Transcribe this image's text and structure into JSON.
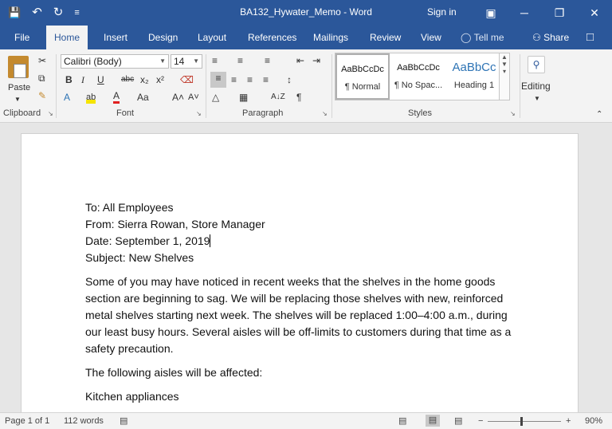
{
  "titlebar": {
    "doc_title": "BA132_Hywater_Memo  -  Word",
    "sign_in": "Sign in",
    "save_icon": "💾",
    "undo_icon": "↶",
    "redo_icon": "↻",
    "customize_icon": "≡",
    "ribbon_display_icon": "▣",
    "minimize_icon": "─",
    "restore_icon": "❐",
    "close_icon": "✕"
  },
  "tabs": [
    {
      "label": "File"
    },
    {
      "label": "Home"
    },
    {
      "label": "Insert"
    },
    {
      "label": "Design"
    },
    {
      "label": "Layout"
    },
    {
      "label": "References"
    },
    {
      "label": "Mailings"
    },
    {
      "label": "Review"
    },
    {
      "label": "View"
    }
  ],
  "tell_me": "Tell me",
  "share": "Share",
  "ribbon": {
    "clipboard": {
      "label": "Clipboard",
      "paste": "Paste"
    },
    "font": {
      "label": "Font",
      "font_name": "Calibri (Body)",
      "font_size": "14",
      "bold": "B",
      "italic": "I",
      "underline": "U",
      "strike": "abc",
      "subscript": "x₂",
      "superscript": "x²",
      "change_case": "Aa",
      "grow": "A˄",
      "shrink": "A˅",
      "font_color": "A",
      "highlight": "ab",
      "effects": "A"
    },
    "paragraph": {
      "label": "Paragraph",
      "pilcrow": "¶",
      "sort": "A↓Z"
    },
    "styles": {
      "label": "Styles",
      "items": [
        {
          "sample": "AaBbCcDc",
          "name": "¶ Normal"
        },
        {
          "sample": "AaBbCcDc",
          "name": "¶ No Spac..."
        },
        {
          "sample": "AaBbCc",
          "name": "Heading 1"
        }
      ]
    },
    "editing": {
      "label": "Editing"
    }
  },
  "document": {
    "to": "To: All Employees",
    "from": "From: Sierra Rowan, Store Manager",
    "date": "Date: September 1, 2019",
    "subject": "Subject: New Shelves",
    "para1": "Some of you may have noticed in recent weeks that the shelves in the home goods section are beginning to sag. We will be replacing those shelves with new, reinforced metal shelves starting next week. The shelves will be replaced 1:00–4:00 a.m., during our least busy hours. Several aisles will be off-limits to customers during that time as a safety precaution.",
    "para2": "The following aisles will be affected:",
    "para3": "Kitchen appliances"
  },
  "statusbar": {
    "page": "Page 1 of 1",
    "words": "112 words",
    "zoom": "90%",
    "zoom_minus": "−",
    "zoom_plus": "+"
  }
}
